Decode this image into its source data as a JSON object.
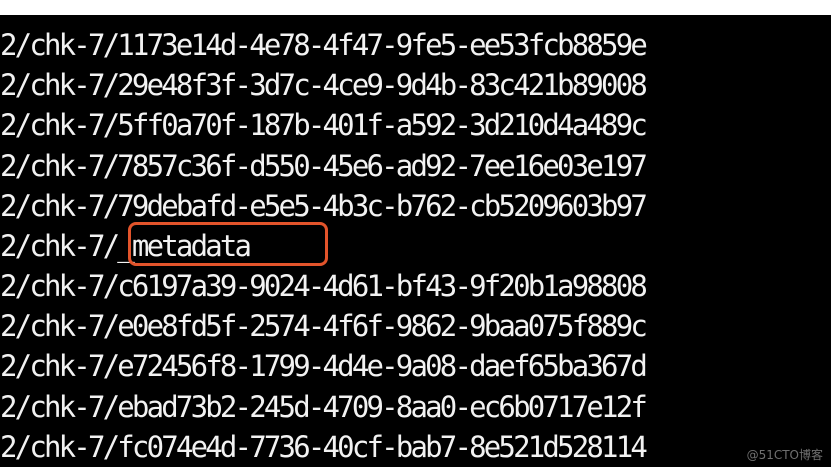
{
  "terminal": {
    "lines": [
      "2/chk-7/1173e14d-4e78-4f47-9fe5-ee53fcb8859e",
      "2/chk-7/29e48f3f-3d7c-4ce9-9d4b-83c421b89008",
      "2/chk-7/5ff0a70f-187b-401f-a592-3d210d4a489c",
      "2/chk-7/7857c36f-d550-45e6-ad92-7ee16e03e197",
      "2/chk-7/79debafd-e5e5-4b3c-b762-cb5209603b97",
      "2/chk-7/_metadata",
      "2/chk-7/c6197a39-9024-4d61-bf43-9f20b1a98808",
      "2/chk-7/e0e8fd5f-2574-4f6f-9862-9baa075f889c",
      "2/chk-7/e72456f8-1799-4d4e-9a08-daef65ba367d",
      "2/chk-7/ebad73b2-245d-4709-8aa0-ec6b0717e12f",
      "2/chk-7/fc074e4d-7736-40cf-bab7-8e521d528114"
    ],
    "highlighted_item": "_metadata"
  },
  "watermark": "@51CTO博客",
  "colors": {
    "background": "#000000",
    "text": "#f2f2f2",
    "highlight_border": "#e2542b"
  }
}
